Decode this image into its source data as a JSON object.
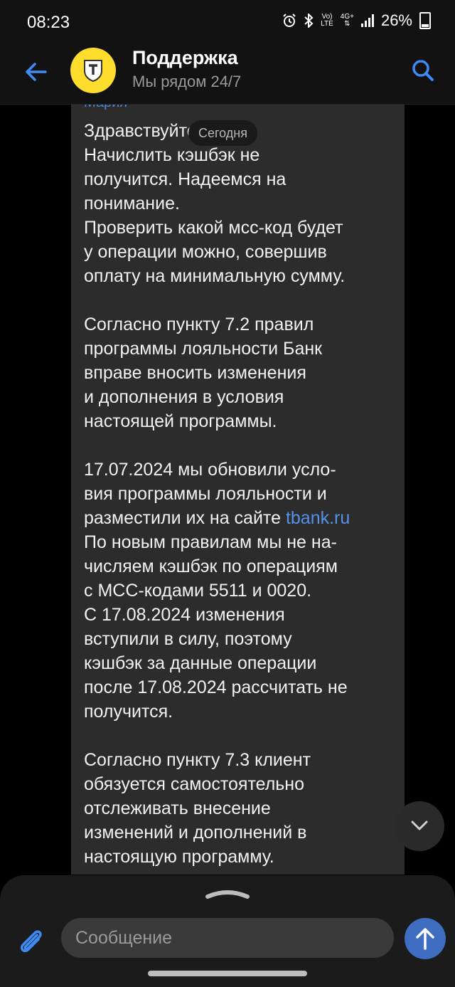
{
  "status_bar": {
    "time": "08:23",
    "network_top": "Vo)",
    "network_bottom": "LTE",
    "network_gen": "4G+",
    "battery": "26%"
  },
  "header": {
    "back_icon": "arrow-left-icon",
    "title": "Поддержка",
    "subtitle": "Мы рядом 24/7",
    "search_icon": "search-icon",
    "accent_color": "#3e8bf5",
    "avatar_color": "#ffdd2d"
  },
  "chat": {
    "sender": "Мария",
    "date_pill": "Сегодня",
    "message": {
      "p1": "Здравствуйте!\nНачислить кэшбэк не\nполучится. Надеемся на\nпонимание.\nПроверить какой мсс-код будет\nу операции можно, совершив\nоплату на минимальную сумму.",
      "p2": "Согласно пункту 7.2 правил\nпрограммы лояльности Банк\nвправе вносить изменения\nи дополнения в условия\nнастоящей программы.",
      "p3_before_link": "17.07.2024 мы обновили усло-\nвия программы лояльности и\nразместили их на сайте ",
      "link": "tbank.ru",
      "p3_after_link": "\nПо новым правилам мы не на-\nчисляем кэшбэк по операциям\nс MCC-кодами 5511 и 0020.\nС 17.08.2024 изменения\nвступили в силу, поэтому\nкэшбэк за данные операции\nпосле 17.08.2024 рассчитать не\nполучится.",
      "p4": "Согласно пункту 7.3 клиент\nобязуется самостоятельно\nотслеживать внесение\nизменений и дополнений в\nнастоящую программу."
    },
    "scroll_down_icon": "chevron-down-icon"
  },
  "composer": {
    "expand_icon": "chevron-up-icon",
    "attach_icon": "paperclip-icon",
    "placeholder": "Сообщение",
    "send_icon": "arrow-up-icon",
    "send_color": "#3e6dc2"
  }
}
